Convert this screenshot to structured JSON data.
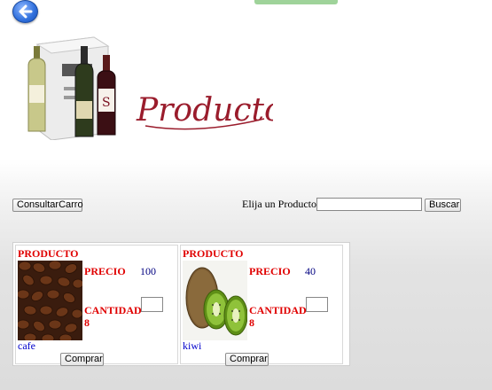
{
  "header": {
    "back_icon": "back-arrow-icon",
    "banner_text": "Productos"
  },
  "toolbar": {
    "consultar_label": "ConsultarCarro",
    "search_label": "Elija un Producto",
    "search_value": "",
    "buscar_label": "Buscar"
  },
  "products": [
    {
      "heading": "PRODUCTO",
      "precio_label": "PRECIO",
      "precio": "100",
      "cantidad_label": "CANTIDAD",
      "cantidad": "8",
      "name": "cafe",
      "comprar_label": "Comprar"
    },
    {
      "heading": "PRODUCTO",
      "precio_label": "PRECIO",
      "precio": "40",
      "cantidad_label": "CANTIDAD",
      "cantidad": "8",
      "name": "kiwi",
      "comprar_label": "Comprar"
    }
  ]
}
